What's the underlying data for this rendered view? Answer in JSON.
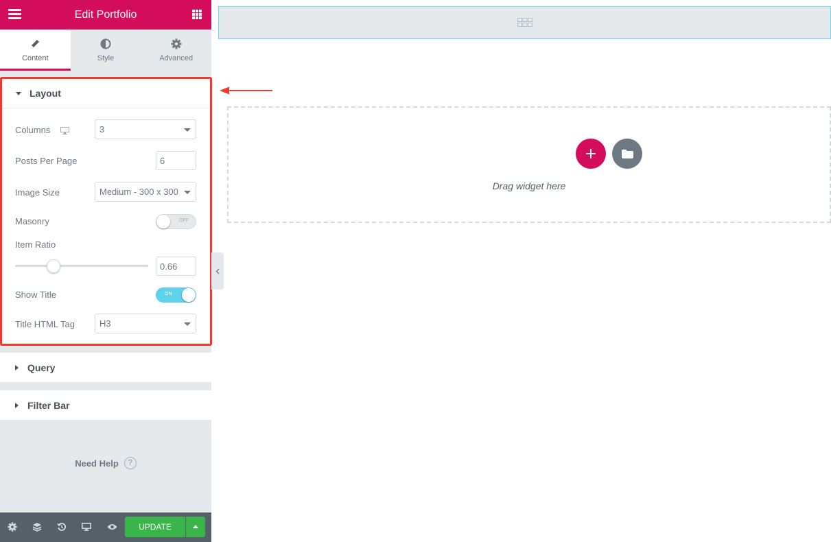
{
  "header": {
    "title": "Edit Portfolio",
    "menu_icon": "hamburger-icon",
    "apps_icon": "grid-icon"
  },
  "tabs": [
    {
      "label": "Content",
      "icon": "pencil-icon",
      "active": true
    },
    {
      "label": "Style",
      "icon": "contrast-icon",
      "active": false
    },
    {
      "label": "Advanced",
      "icon": "gear-icon",
      "active": false
    }
  ],
  "layout": {
    "title": "Layout",
    "columns": {
      "label": "Columns",
      "value": "3",
      "device_icon": "desktop-icon"
    },
    "posts_per_page": {
      "label": "Posts Per Page",
      "value": "6"
    },
    "image_size": {
      "label": "Image Size",
      "value": "Medium - 300 x 300"
    },
    "masonry": {
      "label": "Masonry",
      "state": "OFF"
    },
    "item_ratio": {
      "label": "Item Ratio",
      "value": "0.66",
      "slider_fraction": 0.29
    },
    "show_title": {
      "label": "Show Title",
      "state": "ON"
    },
    "title_html_tag": {
      "label": "Title HTML Tag",
      "value": "H3"
    }
  },
  "sections": {
    "query": "Query",
    "filter_bar": "Filter Bar"
  },
  "need_help": "Need Help",
  "footer": {
    "update_label": "UPDATE",
    "icons": [
      "settings-icon",
      "layers-icon",
      "history-icon",
      "responsive-icon",
      "preview-icon"
    ]
  },
  "canvas": {
    "drag_text": "Drag widget here"
  },
  "colors": {
    "brand": "#d30c5c",
    "highlight": "#f1382f",
    "update": "#39b54a",
    "toggle_on": "#60d1ea"
  }
}
